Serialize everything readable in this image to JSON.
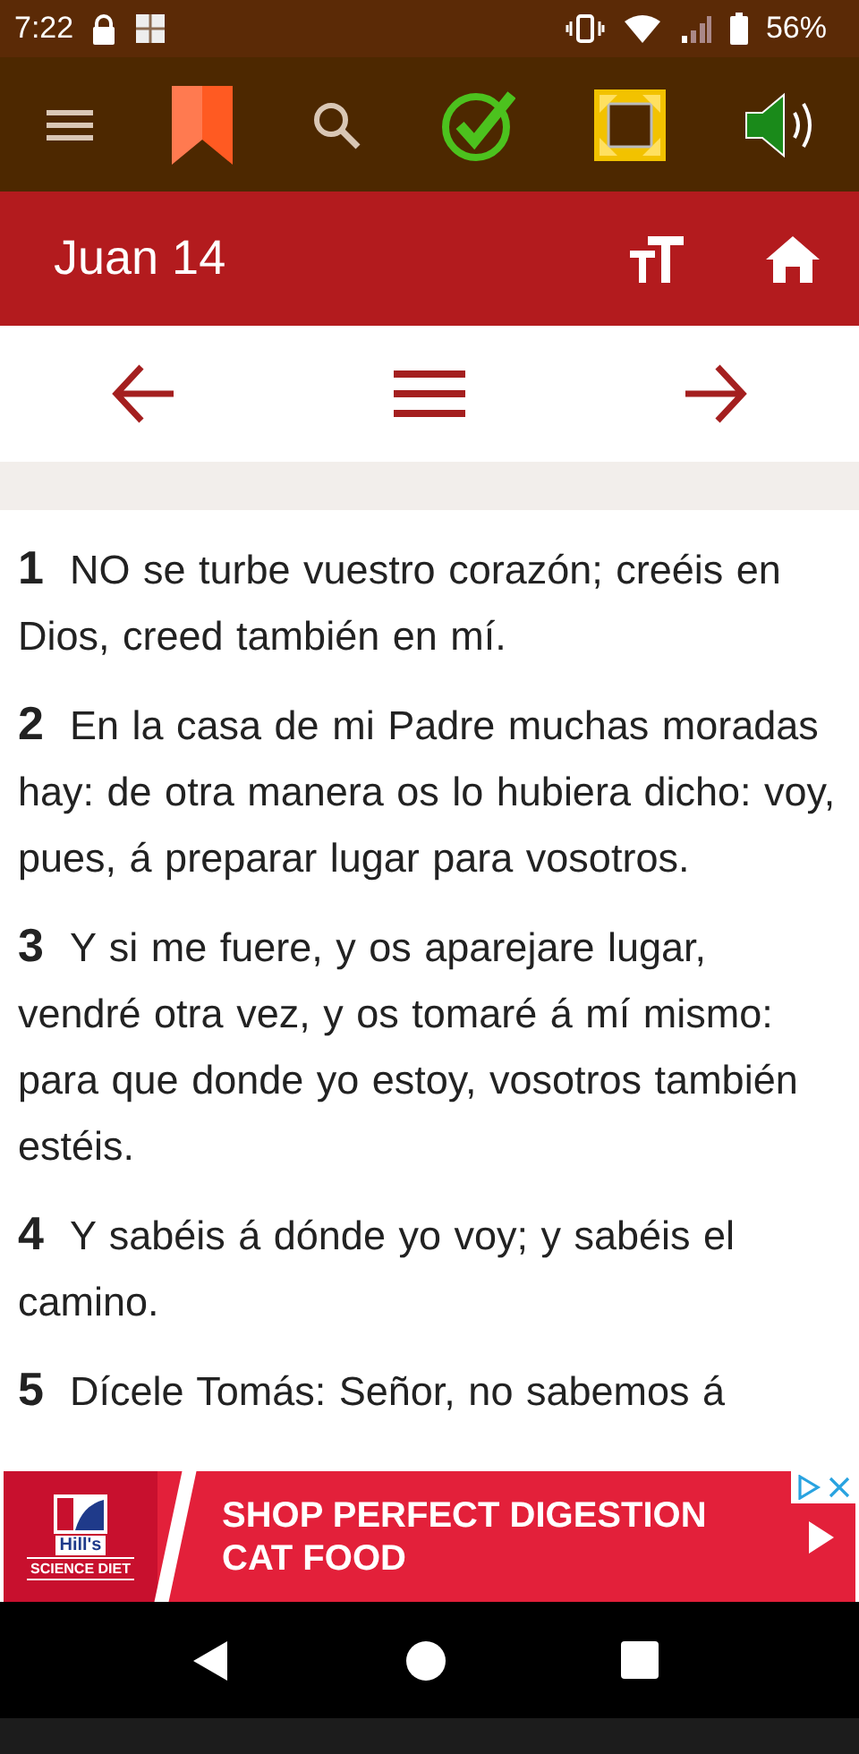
{
  "status_bar": {
    "time": "7:22",
    "battery": "56%"
  },
  "header": {
    "title": "Juan 14"
  },
  "verses": [
    {
      "number": "1",
      "text": "NO se turbe vuestro corazón; creéis en Dios, creed también en mí."
    },
    {
      "number": "2",
      "text": "En la casa de mi Padre muchas moradas hay: de otra manera os lo hubiera dicho: voy, pues, á preparar lugar para vosotros."
    },
    {
      "number": "3",
      "text": "Y si me fuere, y os aparejare lugar, vendré otra vez, y os tomaré á mí mismo: para que donde yo estoy, vosotros también estéis."
    },
    {
      "number": "4",
      "text": "Y sabéis á dónde yo voy; y sabéis el camino."
    },
    {
      "number": "5",
      "text": "Dícele Tomás: Señor, no sabemos á"
    }
  ],
  "ad": {
    "brand": "Hill's",
    "sub_brand": "SCIENCE DIET",
    "headline": [
      "SHOP PERFECT DIGESTION",
      "CAT FOOD"
    ]
  }
}
